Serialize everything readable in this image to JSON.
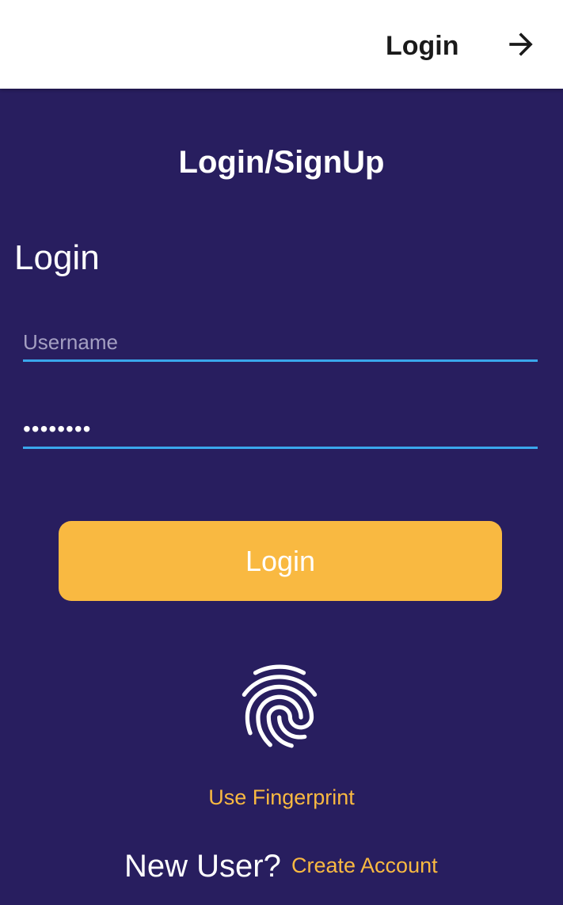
{
  "app_bar": {
    "title": "Login",
    "action_icon": "arrow-right-icon"
  },
  "header": {
    "title": "Login/SignUp"
  },
  "login_form": {
    "section_title": "Login",
    "username": {
      "placeholder": "Username",
      "value": ""
    },
    "password": {
      "value": "••••••••"
    },
    "submit_label": "Login",
    "fingerprint_icon": "fingerprint-icon",
    "fingerprint_label": "Use Fingerprint"
  },
  "footer": {
    "prompt": "New User?",
    "link_label": "Create Account"
  },
  "colors": {
    "background": "#281e5f",
    "accent": "#f9b941",
    "field_underline": "#3aa7ec",
    "app_bar": "#ffffff"
  }
}
